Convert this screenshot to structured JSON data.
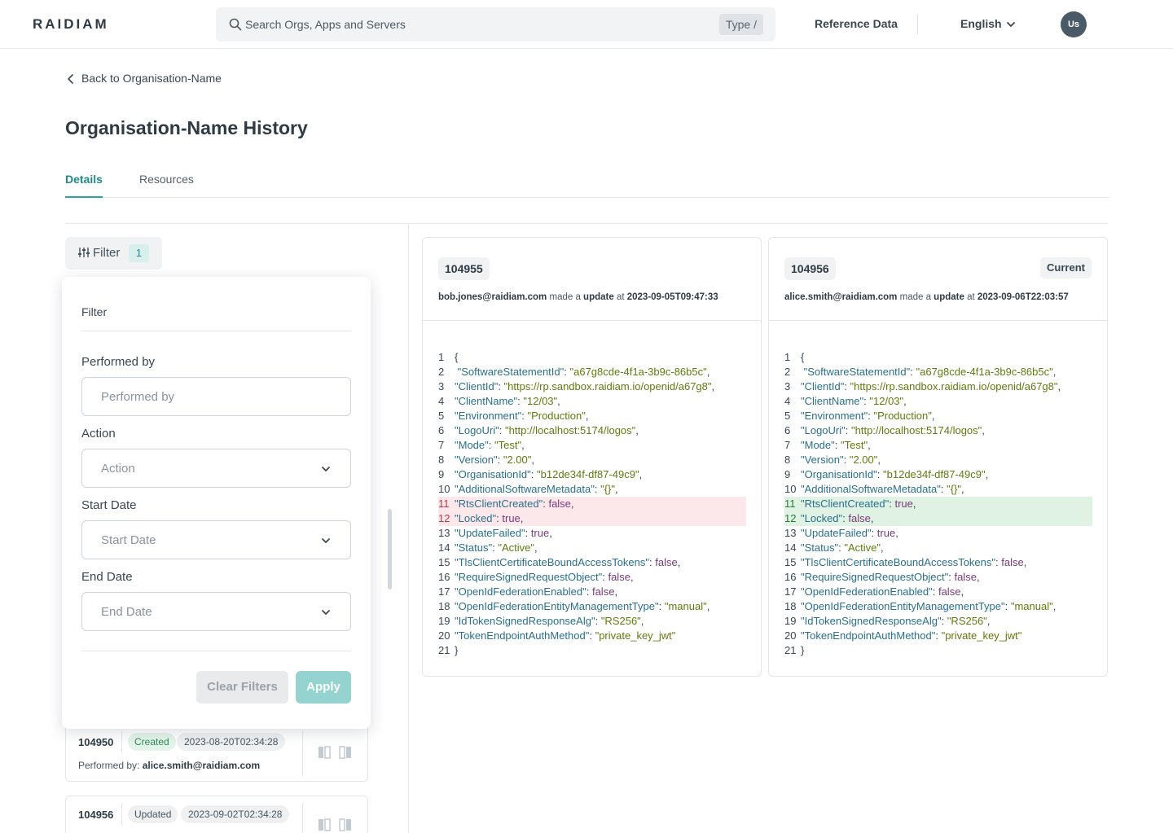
{
  "header": {
    "logo": "RAIDIAM",
    "search_placeholder": "Search Orgs, Apps and Servers",
    "search_badge": "Type /",
    "reference_data": "Reference Data",
    "language": "English",
    "avatar_initials": "Us"
  },
  "page": {
    "back_link": "Back to Organisation-Name",
    "title": "Organisation-Name History",
    "tabs": [
      {
        "label": "Details",
        "active": true
      },
      {
        "label": "Resources",
        "active": false
      }
    ]
  },
  "filter_button": {
    "label": "Filter",
    "count": "1"
  },
  "filter_panel": {
    "title": "Filter",
    "fields": [
      {
        "label": "Performed by",
        "placeholder": "Performed by",
        "type": "text"
      },
      {
        "label": "Action",
        "placeholder": "Action",
        "type": "select"
      },
      {
        "label": "Start Date",
        "placeholder": "Start Date",
        "type": "select"
      },
      {
        "label": "End Date",
        "placeholder": "End Date",
        "type": "select"
      }
    ],
    "clear_label": "Clear Filters",
    "apply_label": "Apply"
  },
  "history": [
    {
      "id": "104950",
      "status": "Created",
      "date": "2023-08-20T02:34:28",
      "performed_by_label": "Performed by:",
      "performed_by": "alice.smith@raidiam.com"
    },
    {
      "id": "104956",
      "status": "Updated",
      "date": "2023-09-02T02:34:28"
    }
  ],
  "diff": {
    "left": {
      "id": "104955",
      "user": "bob.jones@raidiam.com",
      "made_a": "made a",
      "action": "update",
      "at": "at",
      "timestamp": "2023-09-05T09:47:33",
      "lines": [
        {
          "n": "1",
          "text": "{"
        },
        {
          "n": "2",
          "key": "\"SoftwareStatementId\"",
          "val": "\"a67g8cde-4f1a-3b9c-86b5c\"",
          "vt": "s",
          "indent": " "
        },
        {
          "n": "3",
          "key": "\"ClientId\"",
          "val": "\"https://rp.sandbox.raidiam.io/openid/a67g8\"",
          "vt": "s"
        },
        {
          "n": "4",
          "key": "\"ClientName\"",
          "val": "\"12/03\"",
          "vt": "s"
        },
        {
          "n": "5",
          "key": "\"Environment\"",
          "val": "\"Production\"",
          "vt": "s"
        },
        {
          "n": "6",
          "key": "\"LogoUri\"",
          "val": "\"http://localhost:5174/logos\"",
          "vt": "s"
        },
        {
          "n": "7",
          "key": "\"Mode\"",
          "val": "\"Test\"",
          "vt": "s"
        },
        {
          "n": "8",
          "key": "\"Version\"",
          "val": "\"2.00\"",
          "vt": "s"
        },
        {
          "n": "9",
          "key": "\"OrganisationId\"",
          "val": "\"b12de34f-df87-49c9\"",
          "vt": "s"
        },
        {
          "n": "10",
          "key": "\"AdditionalSoftwareMetadata\"",
          "val": "\"{}\"",
          "vt": "s"
        },
        {
          "n": "11",
          "key": "\"RtsClientCreated\"",
          "val": "false",
          "vt": "b",
          "diff": "removed"
        },
        {
          "n": "12",
          "key": "\"Locked\"",
          "val": "true",
          "vt": "b",
          "diff": "removed"
        },
        {
          "n": "13",
          "key": "\"UpdateFailed\"",
          "val": "true",
          "vt": "b"
        },
        {
          "n": "14",
          "key": "\"Status\"",
          "val": "\"Active\"",
          "vt": "s"
        },
        {
          "n": "15",
          "key": "\"TlsClientCertificateBoundAccessTokens\"",
          "val": "false",
          "vt": "b"
        },
        {
          "n": "16",
          "key": "\"RequireSignedRequestObject\"",
          "val": "false",
          "vt": "b"
        },
        {
          "n": "17",
          "key": "\"OpenIdFederationEnabled\"",
          "val": "false",
          "vt": "b"
        },
        {
          "n": "18",
          "key": "\"OpenIdFederationEntityManagementType\"",
          "val": "\"manual\"",
          "vt": "s"
        },
        {
          "n": "19",
          "key": "\"IdTokenSignedResponseAlg\"",
          "val": "\"RS256\"",
          "vt": "s"
        },
        {
          "n": "20",
          "key": "\"TokenEndpointAuthMethod\"",
          "val": "\"private_key_jwt\"",
          "vt": "s",
          "last": true
        },
        {
          "n": "21",
          "text": "}"
        }
      ]
    },
    "right": {
      "id": "104956",
      "current_label": "Current",
      "user": "alice.smith@raidiam.com",
      "made_a": "made a",
      "action": "update",
      "at": "at",
      "timestamp": "2023-09-06T22:03:57",
      "lines": [
        {
          "n": "1",
          "text": "{"
        },
        {
          "n": "2",
          "key": "\"SoftwareStatementId\"",
          "val": "\"a67g8cde-4f1a-3b9c-86b5c\"",
          "vt": "s",
          "indent": " "
        },
        {
          "n": "3",
          "key": "\"ClientId\"",
          "val": "\"https://rp.sandbox.raidiam.io/openid/a67g8\"",
          "vt": "s"
        },
        {
          "n": "4",
          "key": "\"ClientName\"",
          "val": "\"12/03\"",
          "vt": "s"
        },
        {
          "n": "5",
          "key": "\"Environment\"",
          "val": "\"Production\"",
          "vt": "s"
        },
        {
          "n": "6",
          "key": "\"LogoUri\"",
          "val": "\"http://localhost:5174/logos\"",
          "vt": "s"
        },
        {
          "n": "7",
          "key": "\"Mode\"",
          "val": "\"Test\"",
          "vt": "s"
        },
        {
          "n": "8",
          "key": "\"Version\"",
          "val": "\"2.00\"",
          "vt": "s"
        },
        {
          "n": "9",
          "key": "\"OrganisationId\"",
          "val": "\"b12de34f-df87-49c9\"",
          "vt": "s"
        },
        {
          "n": "10",
          "key": "\"AdditionalSoftwareMetadata\"",
          "val": "\"{}\"",
          "vt": "s"
        },
        {
          "n": "11",
          "key": "\"RtsClientCreated\"",
          "val": "true",
          "vt": "b",
          "diff": "added"
        },
        {
          "n": "12",
          "key": "\"Locked\"",
          "val": "false",
          "vt": "b",
          "diff": "added"
        },
        {
          "n": "13",
          "key": "\"UpdateFailed\"",
          "val": "true",
          "vt": "b"
        },
        {
          "n": "14",
          "key": "\"Status\"",
          "val": "\"Active\"",
          "vt": "s"
        },
        {
          "n": "15",
          "key": "\"TlsClientCertificateBoundAccessTokens\"",
          "val": "false",
          "vt": "b"
        },
        {
          "n": "16",
          "key": "\"RequireSignedRequestObject\"",
          "val": "false",
          "vt": "b"
        },
        {
          "n": "17",
          "key": "\"OpenIdFederationEnabled\"",
          "val": "false",
          "vt": "b"
        },
        {
          "n": "18",
          "key": "\"OpenIdFederationEntityManagementType\"",
          "val": "\"manual\"",
          "vt": "s"
        },
        {
          "n": "19",
          "key": "\"IdTokenSignedResponseAlg\"",
          "val": "\"RS256\"",
          "vt": "s"
        },
        {
          "n": "20",
          "key": "\"TokenEndpointAuthMethod\"",
          "val": "\"private_key_jwt\"",
          "vt": "s",
          "last": true
        },
        {
          "n": "21",
          "text": "}"
        }
      ]
    }
  },
  "colors": {
    "accent": "#2ba4a1",
    "removed_bg": "#fce8ea",
    "added_bg": "#dff2e3"
  }
}
